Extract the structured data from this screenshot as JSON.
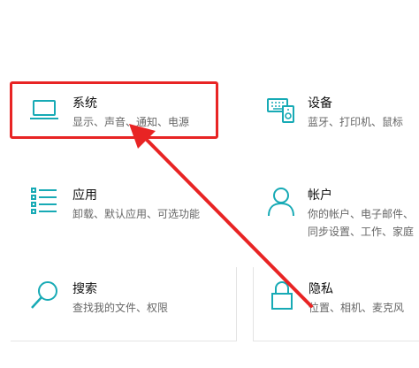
{
  "accent_color": "#17aab5",
  "annotation_color": "#e82424",
  "tiles": {
    "system": {
      "title": "系统",
      "desc": "显示、声音、通知、电源",
      "icon": "laptop-icon"
    },
    "devices": {
      "title": "设备",
      "desc": "蓝牙、打印机、鼠标",
      "icon": "keyboard-phone-icon"
    },
    "apps": {
      "title": "应用",
      "desc": "卸载、默认应用、可选功能",
      "icon": "apps-list-icon"
    },
    "accounts": {
      "title": "帐户",
      "desc": "你的帐户、电子邮件、同步设置、工作、家庭",
      "icon": "person-icon"
    },
    "search": {
      "title": "搜索",
      "desc": "查找我的文件、权限",
      "icon": "search-icon"
    },
    "privacy": {
      "title": "隐私",
      "desc": "位置、相机、麦克风",
      "icon": "lock-icon"
    }
  }
}
